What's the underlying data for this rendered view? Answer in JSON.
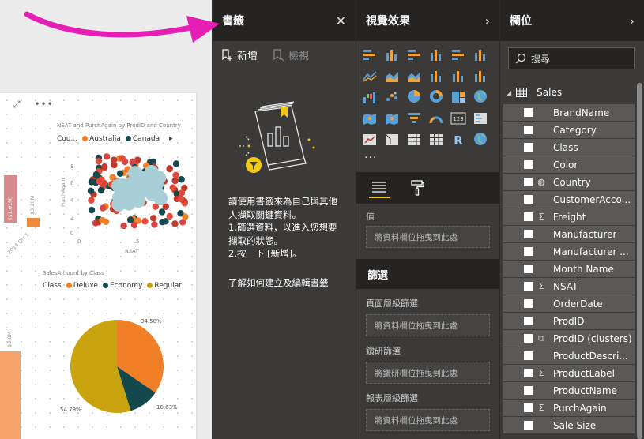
{
  "colors": {
    "pane_bg": "#3b3a39",
    "pane_header": "#252423",
    "accent_yellow": "#f2c811",
    "arrow_magenta": "#e61eb5",
    "series_deluxe": "#f07f25",
    "series_economy": "#13484c",
    "series_regular": "#c9a30e",
    "series_australia": "#f07f25",
    "series_canada": "#13484c"
  },
  "bookmarks": {
    "title": "書籤",
    "close_icon": "close-icon",
    "add_label": "新增",
    "view_label": "檢視",
    "instructions": [
      "請使用書籤來為自己與其他人擷取關鍵資料。",
      "1.篩選資料，以進入您想要擷取的狀態。",
      "2.按一下 [新增]。"
    ],
    "learn_link": "了解如何建立及編輯書籤"
  },
  "visuals": {
    "title": "視覺效果",
    "icons": [
      "stacked-bar-icon",
      "stacked-column-icon",
      "clustered-bar-icon",
      "clustered-column-icon",
      "100-bar-icon",
      "100-column-icon",
      "line-chart-icon",
      "area-chart-icon",
      "stacked-area-icon",
      "line-column-icon",
      "line-clustered-icon",
      "ribbon-icon",
      "waterfall-icon",
      "scatter-icon",
      "pie-icon",
      "donut-icon",
      "treemap-icon",
      "map-icon",
      "filled-map-icon",
      "shape-map-icon",
      "funnel-icon",
      "gauge-icon",
      "card-icon",
      "multirow-card-icon",
      "kpi-icon",
      "slicer-icon",
      "table-icon",
      "matrix-icon",
      "r-visual-icon",
      "globe-icon"
    ],
    "more": "...",
    "values_label": "值",
    "values_drop": "將資料欄位拖曳到此處",
    "filters_title": "篩選",
    "page_filters": "頁面層級篩選",
    "page_drop": "將資料欄位拖曳到此處",
    "drill_filters": "鑽研篩選",
    "drill_drop": "將鑽研欄位拖曳到此處",
    "report_filters": "報表層級篩選",
    "report_drop": "將資料欄位拖曳到此處"
  },
  "fields": {
    "title": "欄位",
    "search_placeholder": "搜尋",
    "table_name": "Sales",
    "items": [
      {
        "name": "BrandName",
        "type": ""
      },
      {
        "name": "Category",
        "type": ""
      },
      {
        "name": "Class",
        "type": ""
      },
      {
        "name": "Color",
        "type": ""
      },
      {
        "name": "Country",
        "type": "globe"
      },
      {
        "name": "CustomerAcco...",
        "type": ""
      },
      {
        "name": "Freight",
        "type": "Σ"
      },
      {
        "name": "Manufacturer",
        "type": ""
      },
      {
        "name": "Manufacturer ...",
        "type": ""
      },
      {
        "name": "Month Name",
        "type": ""
      },
      {
        "name": "NSAT",
        "type": "Σ"
      },
      {
        "name": "OrderDate",
        "type": ""
      },
      {
        "name": "ProdID",
        "type": ""
      },
      {
        "name": "ProdID (clusters)",
        "type": "cluster"
      },
      {
        "name": "ProductDescri...",
        "type": ""
      },
      {
        "name": "ProductLabel",
        "type": "Σ"
      },
      {
        "name": "ProductName",
        "type": ""
      },
      {
        "name": "PurchAgain",
        "type": "Σ"
      },
      {
        "name": "Sale Size",
        "type": ""
      }
    ]
  },
  "canvas": {
    "scatter_title": "NSAT and PurchAgain by ProdID and Country",
    "scatter_legend_title": "Cou...",
    "scatter_legend": [
      "Australia",
      "Canada"
    ],
    "scatter_xlabel": "NSAT",
    "scatter_ylabel": "PurchAgain",
    "scatter_yticks": [
      "8",
      "6",
      "4",
      "2",
      "0"
    ],
    "scatter_xticks": [
      "0",
      "5"
    ],
    "pie_title": "SalesAmount by Class",
    "pie_legend_title": "Class",
    "pie_legend": [
      "Deluxe",
      "Economy",
      "Regular"
    ],
    "pie_labels": [
      "34.58%",
      "10.63%",
      "54.79%"
    ],
    "bar_labels": [
      "($1.01M)",
      "$3.20M",
      "2014 Qtr 1",
      "$3.8M"
    ]
  },
  "chart_data": [
    {
      "type": "pie",
      "title": "SalesAmount by Class",
      "categories": [
        "Deluxe",
        "Economy",
        "Regular"
      ],
      "values": [
        34.58,
        10.63,
        54.79
      ]
    }
  ]
}
